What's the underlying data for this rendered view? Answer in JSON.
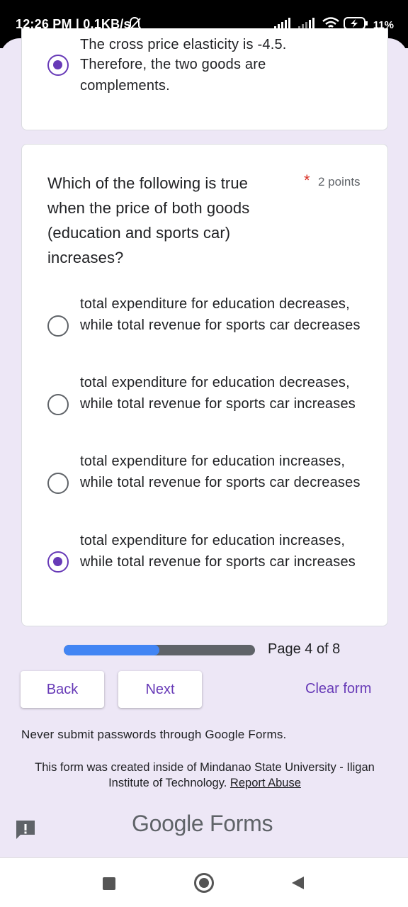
{
  "status_bar": {
    "time": "12:26 PM | 0.1KB/s",
    "battery": "11%"
  },
  "previous_question": {
    "partial_line": "The cross price elasticity is -4.5.",
    "selected_option_text": "Therefore, the two goods are complements."
  },
  "question": {
    "title": "Which of the following is true when the price of both goods (education and sports car) increases?",
    "required_marker": "*",
    "points": "2 points",
    "options": [
      {
        "text": "total expenditure for education decreases, while total revenue for sports car decreases",
        "selected": false
      },
      {
        "text": "total expenditure for education decreases, while total revenue for sports car increases",
        "selected": false
      },
      {
        "text": "total expenditure for education increases, while total revenue for sports car decreases",
        "selected": false
      },
      {
        "text": "total expenditure for education increases, while total revenue for sports car increases",
        "selected": true
      }
    ]
  },
  "progress": {
    "label": "Page 4 of 8",
    "fraction": 0.5
  },
  "buttons": {
    "back": "Back",
    "next": "Next",
    "clear": "Clear form"
  },
  "footer": {
    "warning": "Never submit passwords through Google Forms.",
    "created_text": "This form was created inside of Mindanao State University - Iligan Institute of Technology.",
    "report_link": "Report Abuse",
    "logo_google": "Google",
    "logo_forms": "Forms"
  },
  "colors": {
    "accent": "#673ab7",
    "background": "#ede7f6",
    "progress_fill": "#4285f4",
    "required": "#d93025"
  },
  "icons": [
    "bell-off-icon",
    "signal-icon",
    "wifi-icon",
    "battery-icon",
    "feedback-icon",
    "nav-recents-icon",
    "nav-home-icon",
    "nav-back-icon"
  ]
}
